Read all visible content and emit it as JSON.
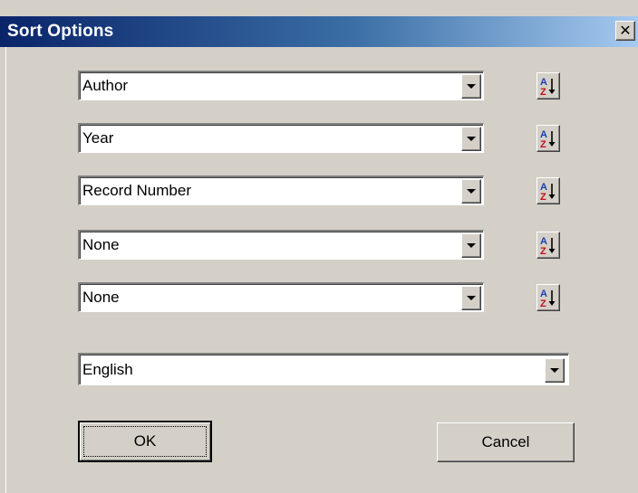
{
  "window": {
    "title": "Sort Options",
    "close_glyph": "✕"
  },
  "sort_fields": [
    {
      "value": "Author",
      "order_icon": "sort-ascending-az-icon"
    },
    {
      "value": "Year",
      "order_icon": "sort-ascending-az-icon"
    },
    {
      "value": "Record Number",
      "order_icon": "sort-ascending-az-icon"
    },
    {
      "value": "None",
      "order_icon": "sort-ascending-az-icon"
    },
    {
      "value": "None",
      "order_icon": "sort-ascending-az-icon"
    }
  ],
  "language": {
    "value": "English"
  },
  "buttons": {
    "ok_label": "OK",
    "cancel_label": "Cancel"
  },
  "colors": {
    "dialog_face": "#d4d0c8",
    "title_gradient_start": "#0a246a",
    "title_gradient_end": "#a6caf0",
    "sort_icon_a": "#1a3fb0",
    "sort_icon_z": "#c0101a"
  }
}
